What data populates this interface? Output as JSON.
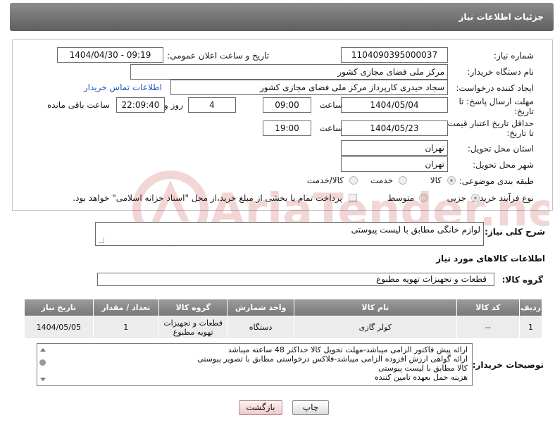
{
  "header": {
    "title": "جزئیات اطلاعات نیاز"
  },
  "form": {
    "need_number_label": "شماره نیاز:",
    "need_number": "1104090395000037",
    "announce_label": "تاریخ و ساعت اعلان عمومی:",
    "announce_value": "1404/04/30 - 09:19",
    "buyer_org_label": "نام دستگاه خریدار:",
    "buyer_org": "مرکز ملی فضای مجازی کشور",
    "requester_label": "ایجاد کننده درخواست:",
    "requester": "سجاد حیدری کارپرداز مرکز ملی فضای مجازی کشور",
    "contact_link": "اطلاعات تماس خریدار",
    "deadline_label_1": "مهلت ارسال پاسخ: تا",
    "deadline_label_2": "تاریخ:",
    "deadline_date": "1404/05/04",
    "time_label": "ساعت",
    "deadline_time": "09:00",
    "days_value": "4",
    "days_label": "روز و",
    "remaining_time": "22:09:40",
    "remaining_label": "ساعت باقی مانده",
    "validity_label_1": "حداقل تاریخ اعتبار قیمت:",
    "validity_label_2": "تا تاریخ:",
    "validity_date": "1404/05/23",
    "validity_time": "19:00",
    "province_label": "استان محل تحویل:",
    "province": "تهران",
    "city_label": "شهر محل تحویل:",
    "city": "تهران",
    "category_label": "طبقه بندی موضوعی:",
    "category_options": [
      "کالا",
      "خدمت",
      "کالا/خدمت"
    ],
    "process_label": "نوع فرآیند خرید :",
    "process_options": [
      "جزیی",
      "متوسط"
    ],
    "payment_note": "پرداخت تمام یا بخشی از مبلغ خرید،از محل \"اسناد خزانه اسلامی\" خواهد بود."
  },
  "description": {
    "label": "شرح کلی نیاز:",
    "value": "لوازم خانگی مطابق با لیست پیوستی"
  },
  "goods_info": {
    "title": "اطلاعات کالاهای مورد نیاز",
    "group_label": "گروه کالا:",
    "group_value": "قطعات و تجهیزات تهویه مطبوع"
  },
  "table": {
    "headers": [
      "ردیف",
      "کد کالا",
      "نام کالا",
      "واحد شمارش",
      "گروه کالا",
      "تعداد / مقدار",
      "تاریخ نیاز"
    ],
    "rows": [
      [
        "1",
        "--",
        "کولر گازی",
        "دستگاه",
        "قطعات و تجهیزات تهویه مطبوع",
        "1",
        "1404/05/05"
      ]
    ]
  },
  "buyer_notes": {
    "label": "توضیحات خریدار:",
    "lines": [
      "ارائه پیش فاکتور الزامی میباشد-مهلت تحویل کالا حداکثر 48 ساعته میباشد",
      "ارائه گواهی ارزش افزوده الزامی میباشد-فلاکس درخواستی مطابق با تصویر پیوستی",
      "کالا مطابق با لیست پیوستی",
      "هزینه حمل بعهده تامین کننده"
    ]
  },
  "buttons": {
    "print": "چاپ",
    "back": "بازگشت"
  },
  "watermark": {
    "text": "AriaTender.net"
  }
}
